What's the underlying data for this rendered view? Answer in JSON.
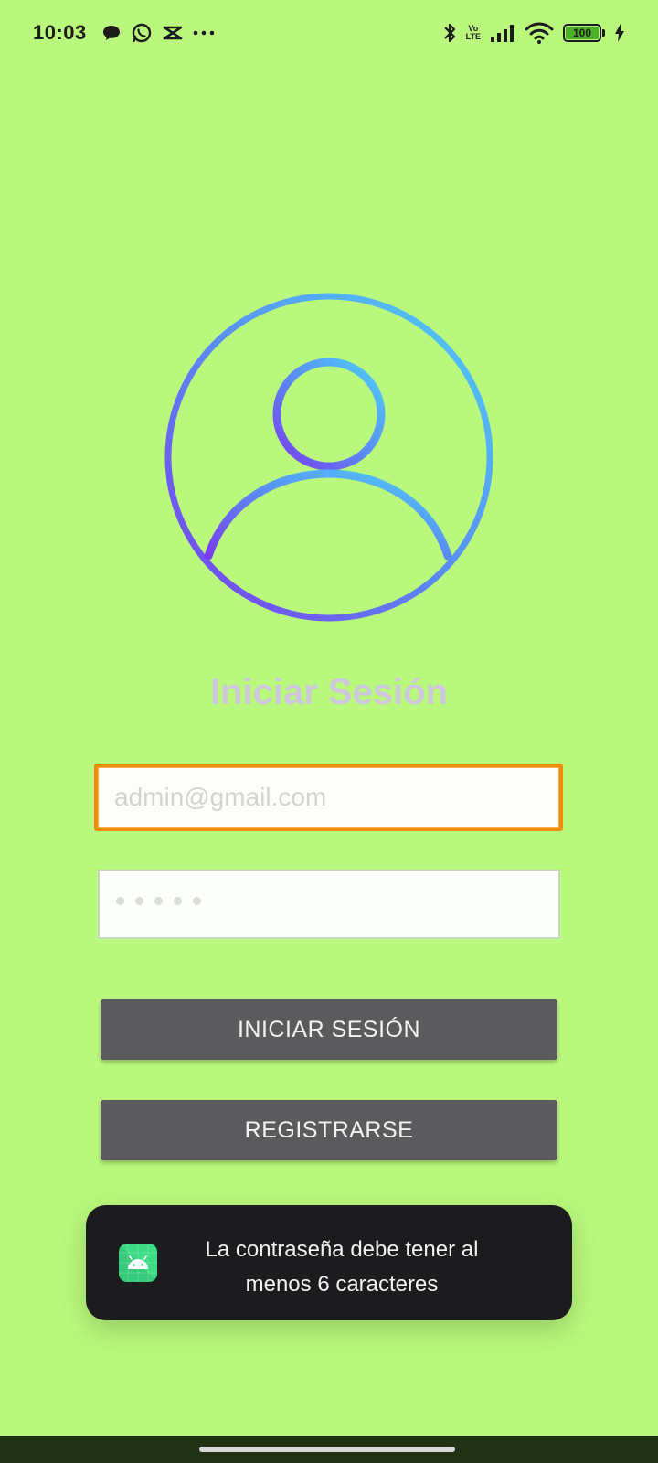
{
  "status_bar": {
    "time": "10:03",
    "volte_top": "Vo",
    "volte_bottom": "LTE",
    "battery_level": "100",
    "left_icons": [
      "chat-bubble-icon",
      "whatsapp-icon",
      "capcut-icon",
      "more-notifications-icon"
    ],
    "right_icons": [
      "bluetooth-icon",
      "volte-icon",
      "signal-icon",
      "wifi-icon",
      "battery-icon",
      "charging-icon"
    ]
  },
  "login": {
    "title": "Iniciar Sesión",
    "email_placeholder": "admin@gmail.com",
    "email_value": "",
    "password_dots": 5,
    "login_button": "INICIAR SESIÓN",
    "register_button": "REGISTRARSE"
  },
  "toast": {
    "icon": "android-app-icon",
    "line1": "La contraseña debe tener al",
    "line2": "menos 6 caracteres"
  },
  "colors": {
    "background": "#b9f87c",
    "title": "#cdc8dc",
    "input_focus_border": "#f28b0d",
    "button": "#5b5b5d",
    "toast_bg": "#1c1c1e",
    "avatar_gradient_start": "#4fd0fa",
    "avatar_gradient_end": "#7a3cf0"
  }
}
